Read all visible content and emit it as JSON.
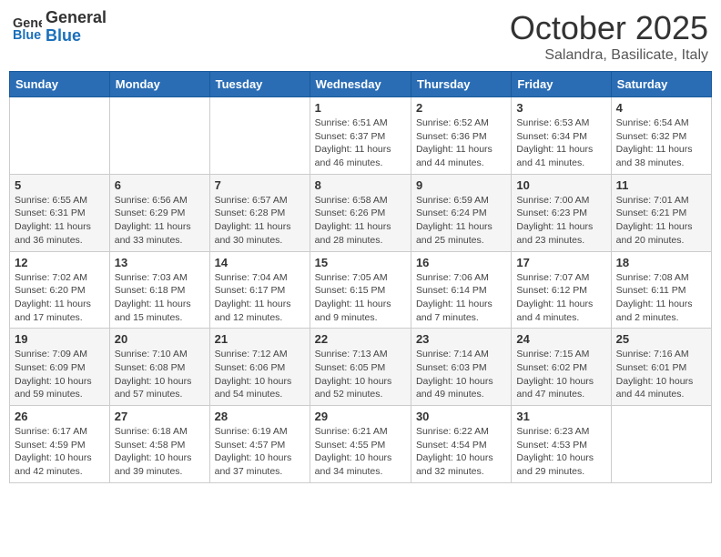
{
  "header": {
    "logo_general": "General",
    "logo_blue": "Blue",
    "month_title": "October 2025",
    "subtitle": "Salandra, Basilicate, Italy"
  },
  "days_of_week": [
    "Sunday",
    "Monday",
    "Tuesday",
    "Wednesday",
    "Thursday",
    "Friday",
    "Saturday"
  ],
  "weeks": [
    [
      {
        "day": "",
        "info": ""
      },
      {
        "day": "",
        "info": ""
      },
      {
        "day": "",
        "info": ""
      },
      {
        "day": "1",
        "info": "Sunrise: 6:51 AM\nSunset: 6:37 PM\nDaylight: 11 hours and 46 minutes."
      },
      {
        "day": "2",
        "info": "Sunrise: 6:52 AM\nSunset: 6:36 PM\nDaylight: 11 hours and 44 minutes."
      },
      {
        "day": "3",
        "info": "Sunrise: 6:53 AM\nSunset: 6:34 PM\nDaylight: 11 hours and 41 minutes."
      },
      {
        "day": "4",
        "info": "Sunrise: 6:54 AM\nSunset: 6:32 PM\nDaylight: 11 hours and 38 minutes."
      }
    ],
    [
      {
        "day": "5",
        "info": "Sunrise: 6:55 AM\nSunset: 6:31 PM\nDaylight: 11 hours and 36 minutes."
      },
      {
        "day": "6",
        "info": "Sunrise: 6:56 AM\nSunset: 6:29 PM\nDaylight: 11 hours and 33 minutes."
      },
      {
        "day": "7",
        "info": "Sunrise: 6:57 AM\nSunset: 6:28 PM\nDaylight: 11 hours and 30 minutes."
      },
      {
        "day": "8",
        "info": "Sunrise: 6:58 AM\nSunset: 6:26 PM\nDaylight: 11 hours and 28 minutes."
      },
      {
        "day": "9",
        "info": "Sunrise: 6:59 AM\nSunset: 6:24 PM\nDaylight: 11 hours and 25 minutes."
      },
      {
        "day": "10",
        "info": "Sunrise: 7:00 AM\nSunset: 6:23 PM\nDaylight: 11 hours and 23 minutes."
      },
      {
        "day": "11",
        "info": "Sunrise: 7:01 AM\nSunset: 6:21 PM\nDaylight: 11 hours and 20 minutes."
      }
    ],
    [
      {
        "day": "12",
        "info": "Sunrise: 7:02 AM\nSunset: 6:20 PM\nDaylight: 11 hours and 17 minutes."
      },
      {
        "day": "13",
        "info": "Sunrise: 7:03 AM\nSunset: 6:18 PM\nDaylight: 11 hours and 15 minutes."
      },
      {
        "day": "14",
        "info": "Sunrise: 7:04 AM\nSunset: 6:17 PM\nDaylight: 11 hours and 12 minutes."
      },
      {
        "day": "15",
        "info": "Sunrise: 7:05 AM\nSunset: 6:15 PM\nDaylight: 11 hours and 9 minutes."
      },
      {
        "day": "16",
        "info": "Sunrise: 7:06 AM\nSunset: 6:14 PM\nDaylight: 11 hours and 7 minutes."
      },
      {
        "day": "17",
        "info": "Sunrise: 7:07 AM\nSunset: 6:12 PM\nDaylight: 11 hours and 4 minutes."
      },
      {
        "day": "18",
        "info": "Sunrise: 7:08 AM\nSunset: 6:11 PM\nDaylight: 11 hours and 2 minutes."
      }
    ],
    [
      {
        "day": "19",
        "info": "Sunrise: 7:09 AM\nSunset: 6:09 PM\nDaylight: 10 hours and 59 minutes."
      },
      {
        "day": "20",
        "info": "Sunrise: 7:10 AM\nSunset: 6:08 PM\nDaylight: 10 hours and 57 minutes."
      },
      {
        "day": "21",
        "info": "Sunrise: 7:12 AM\nSunset: 6:06 PM\nDaylight: 10 hours and 54 minutes."
      },
      {
        "day": "22",
        "info": "Sunrise: 7:13 AM\nSunset: 6:05 PM\nDaylight: 10 hours and 52 minutes."
      },
      {
        "day": "23",
        "info": "Sunrise: 7:14 AM\nSunset: 6:03 PM\nDaylight: 10 hours and 49 minutes."
      },
      {
        "day": "24",
        "info": "Sunrise: 7:15 AM\nSunset: 6:02 PM\nDaylight: 10 hours and 47 minutes."
      },
      {
        "day": "25",
        "info": "Sunrise: 7:16 AM\nSunset: 6:01 PM\nDaylight: 10 hours and 44 minutes."
      }
    ],
    [
      {
        "day": "26",
        "info": "Sunrise: 6:17 AM\nSunset: 4:59 PM\nDaylight: 10 hours and 42 minutes."
      },
      {
        "day": "27",
        "info": "Sunrise: 6:18 AM\nSunset: 4:58 PM\nDaylight: 10 hours and 39 minutes."
      },
      {
        "day": "28",
        "info": "Sunrise: 6:19 AM\nSunset: 4:57 PM\nDaylight: 10 hours and 37 minutes."
      },
      {
        "day": "29",
        "info": "Sunrise: 6:21 AM\nSunset: 4:55 PM\nDaylight: 10 hours and 34 minutes."
      },
      {
        "day": "30",
        "info": "Sunrise: 6:22 AM\nSunset: 4:54 PM\nDaylight: 10 hours and 32 minutes."
      },
      {
        "day": "31",
        "info": "Sunrise: 6:23 AM\nSunset: 4:53 PM\nDaylight: 10 hours and 29 minutes."
      },
      {
        "day": "",
        "info": ""
      }
    ]
  ]
}
